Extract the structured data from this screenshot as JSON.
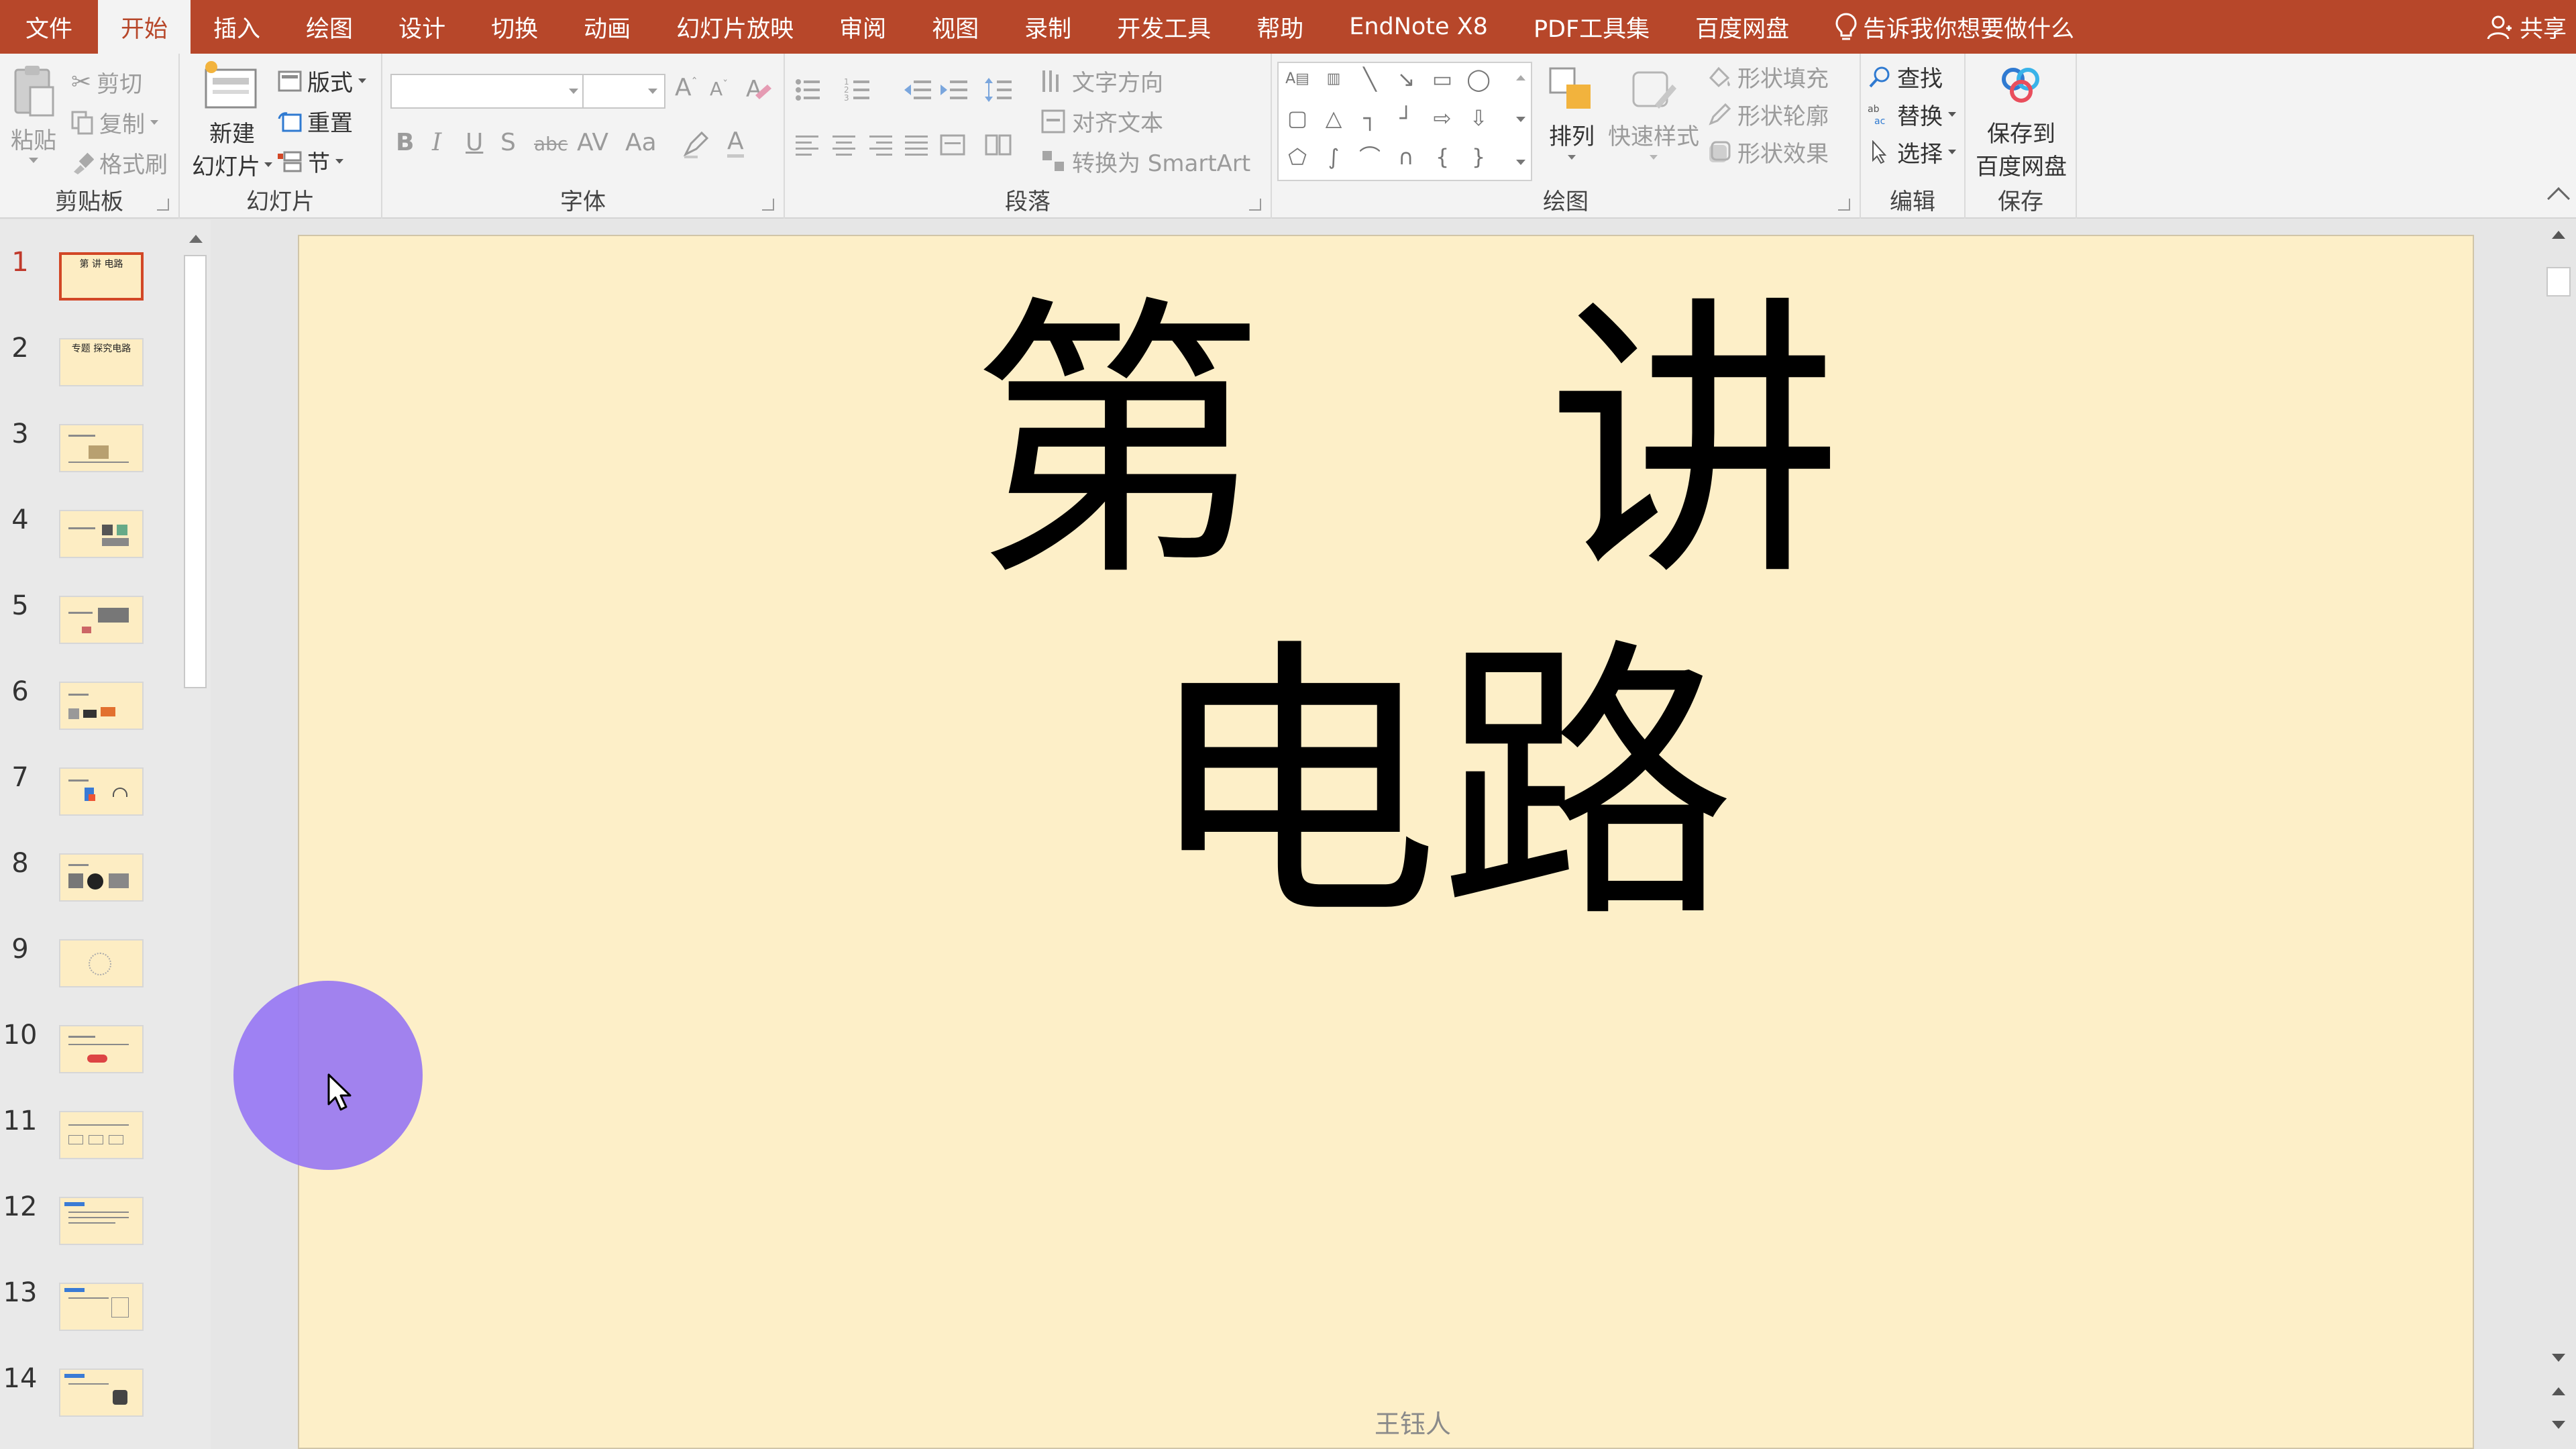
{
  "tabs": [
    {
      "label": "文件",
      "active": false
    },
    {
      "label": "开始",
      "active": true
    },
    {
      "label": "插入",
      "active": false
    },
    {
      "label": "绘图",
      "active": false
    },
    {
      "label": "设计",
      "active": false
    },
    {
      "label": "切换",
      "active": false
    },
    {
      "label": "动画",
      "active": false
    },
    {
      "label": "幻灯片放映",
      "active": false
    },
    {
      "label": "审阅",
      "active": false
    },
    {
      "label": "视图",
      "active": false
    },
    {
      "label": "录制",
      "active": false
    },
    {
      "label": "开发工具",
      "active": false
    },
    {
      "label": "帮助",
      "active": false
    },
    {
      "label": "EndNote X8",
      "active": false
    },
    {
      "label": "PDF工具集",
      "active": false
    },
    {
      "label": "百度网盘",
      "active": false
    }
  ],
  "tell_me": "告诉我你想要做什么",
  "share": "共享",
  "ribbon": {
    "clipboard": {
      "label": "剪贴板",
      "paste": "粘贴",
      "cut": "剪切",
      "copy": "复制",
      "format_painter": "格式刷"
    },
    "slides": {
      "label": "幻灯片",
      "new_slide_line1": "新建",
      "new_slide_line2": "幻灯片",
      "layout": "版式",
      "reset": "重置",
      "section": "节"
    },
    "font": {
      "label": "字体",
      "bold": "B",
      "italic": "I",
      "underline": "U",
      "shadow": "S",
      "strike": "abc",
      "spacing": "AV",
      "case": "Aa",
      "color": "A"
    },
    "paragraph": {
      "label": "段落",
      "text_direction": "文字方向",
      "align_text": "对齐文本",
      "smartart": "转换为 SmartArt"
    },
    "drawing": {
      "label": "绘图",
      "arrange": "排列",
      "quick_styles": "快速样式",
      "shape_fill": "形状填充",
      "shape_outline": "形状轮廓",
      "shape_effects": "形状效果"
    },
    "editing": {
      "label": "编辑",
      "find": "查找",
      "replace": "替换",
      "select": "选择"
    },
    "save": {
      "label": "保存",
      "save_to_line1": "保存到",
      "save_to_line2": "百度网盘"
    }
  },
  "thumbnails": [
    {
      "number": "1",
      "active": true,
      "title": "第 讲 电路"
    },
    {
      "number": "2",
      "active": false,
      "title": "专题 探究电路"
    },
    {
      "number": "3",
      "active": false,
      "title": ""
    },
    {
      "number": "4",
      "active": false,
      "title": ""
    },
    {
      "number": "5",
      "active": false,
      "title": ""
    },
    {
      "number": "6",
      "active": false,
      "title": ""
    },
    {
      "number": "7",
      "active": false,
      "title": ""
    },
    {
      "number": "8",
      "active": false,
      "title": ""
    },
    {
      "number": "9",
      "active": false,
      "title": ""
    },
    {
      "number": "10",
      "active": false,
      "title": ""
    },
    {
      "number": "11",
      "active": false,
      "title": ""
    },
    {
      "number": "12",
      "active": false,
      "title": ""
    },
    {
      "number": "13",
      "active": false,
      "title": ""
    },
    {
      "number": "14",
      "active": false,
      "title": ""
    }
  ],
  "slide": {
    "title_char_1": "第",
    "title_char_2": "讲",
    "subtitle": "电路",
    "footer": "王钰人"
  },
  "colors": {
    "accent": "#b7472a",
    "slide_bg": "#fdefc8",
    "cursor_highlight": "#9b6ef5"
  }
}
